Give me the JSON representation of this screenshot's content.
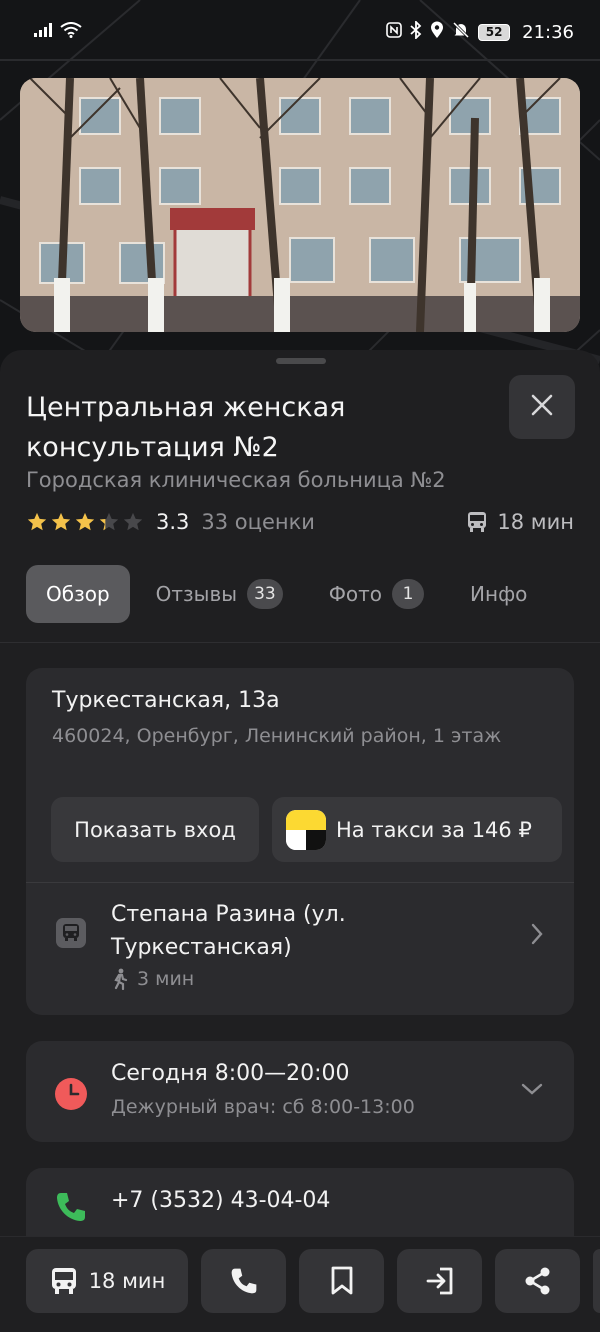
{
  "status_bar": {
    "signal_icon": "signal-icon",
    "wifi_icon": "wifi-icon",
    "nfc_icon": "nfc-icon",
    "bluetooth_icon": "bluetooth-icon",
    "location_icon": "location-icon",
    "mute_icon": "bell-off-icon",
    "battery": "52",
    "time": "21:36"
  },
  "place": {
    "title": "Центральная женская консультация №2",
    "subtitle": "Городская клиническая больница №2",
    "rating_value": "3.3",
    "rating_stars": 3.3,
    "rating_count": "33 оценки",
    "eta": "18 мин"
  },
  "tabs": [
    {
      "label": "Обзор",
      "badge": ""
    },
    {
      "label": "Отзывы",
      "badge": "33"
    },
    {
      "label": "Фото",
      "badge": "1"
    },
    {
      "label": "Инфо",
      "badge": ""
    }
  ],
  "address": {
    "street": "Туркестанская, 13а",
    "details": "460024, Оренбург, Ленинский район, 1 этаж",
    "entrance_button": "Показать вход",
    "taxi_button": "На такси за 146 ₽",
    "transit_stop": "Степана Разина (ул. Туркестанская)",
    "walk_time": "3 мин"
  },
  "hours": {
    "main": "Сегодня 8:00—20:00",
    "sub": "Дежурный врач: сб 8:00-13:00"
  },
  "phone": {
    "number": "+7 (3532) 43-04-04"
  },
  "bottom_bar": {
    "route_label": "18 мин"
  },
  "colors": {
    "accent_star": "#f4c24a",
    "clock_red": "#f05a5a",
    "phone_green": "#3dbb5a"
  }
}
